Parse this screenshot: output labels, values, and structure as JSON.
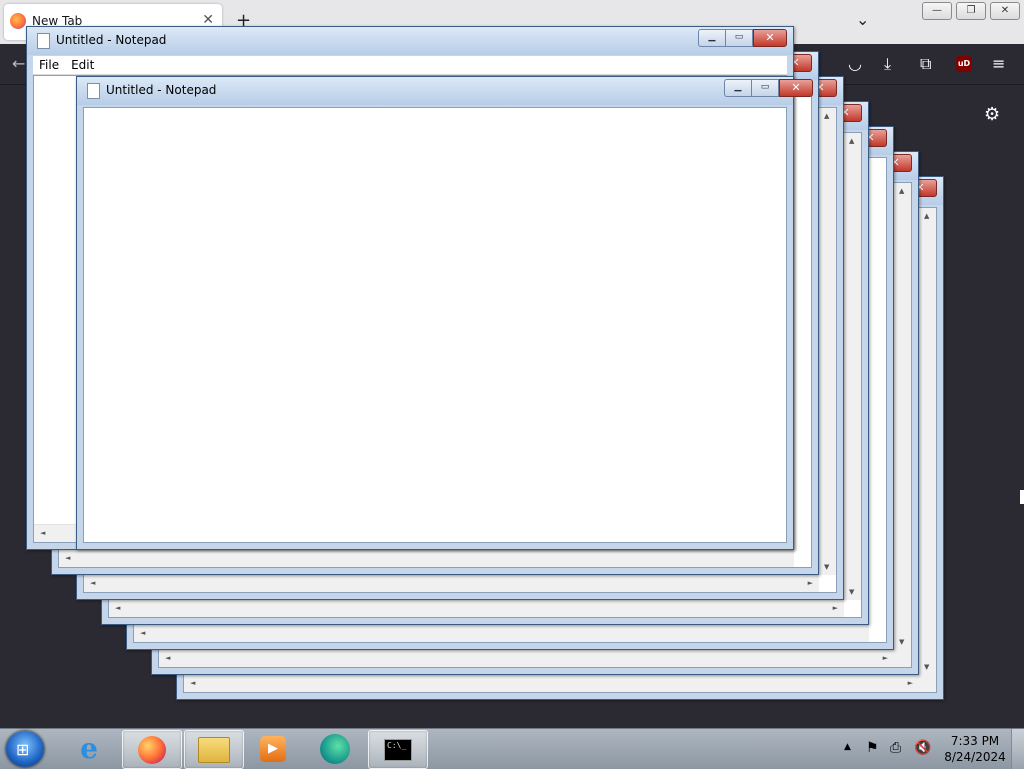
{
  "firefox": {
    "tab_title": "New Tab",
    "tab_close": "✕",
    "new_tab": "+",
    "list_tabs": "⌄",
    "win_buttons": [
      "—",
      "❐",
      "✕"
    ],
    "back": "←",
    "toolbar_icons": [
      "pocket-icon",
      "download-icon",
      "extensions-icon",
      "ublock-icon",
      "menu-icon"
    ],
    "ublock_label": "uD",
    "menu_glyph": "≡",
    "gear_glyph": "⚙"
  },
  "notepad": {
    "window_title": "Untitled - Notepad",
    "menu": [
      "File",
      "Edit"
    ],
    "buttons": {
      "minimize": "▁",
      "maximize": "▭",
      "close": "✕"
    },
    "scroll": {
      "up": "▲",
      "down": "▼",
      "left": "◄",
      "right": "►"
    }
  },
  "taskbar": {
    "apps": [
      "internet-explorer",
      "firefox",
      "file-explorer",
      "media-player",
      "edge",
      "command-prompt"
    ],
    "ie_glyph": "e",
    "media_glyph": "▶",
    "cmd_glyph": "C:\\_",
    "tray_arrow": "▲",
    "clock_time": "7:33 PM",
    "clock_date": "8/24/2024"
  }
}
